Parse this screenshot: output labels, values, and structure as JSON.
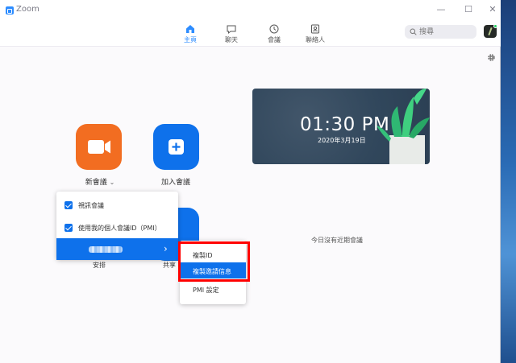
{
  "window": {
    "title": "Zoom"
  },
  "nav": {
    "tabs": [
      {
        "label": "主頁",
        "icon": "home-icon"
      },
      {
        "label": "聊天",
        "icon": "chat-icon"
      },
      {
        "label": "會議",
        "icon": "clock-icon"
      },
      {
        "label": "聯絡人",
        "icon": "contacts-icon"
      }
    ],
    "active_index": 0
  },
  "search": {
    "placeholder": "搜尋"
  },
  "actions": {
    "new_meeting_label": "新會議",
    "join_label": "加入會議",
    "schedule_label_partial": "安排",
    "share_label_partial": "共享"
  },
  "clock": {
    "time": "01:30 PM",
    "date": "2020年3月19日"
  },
  "no_meetings": "今日沒有近期會議",
  "new_meeting_menu": {
    "items": [
      {
        "label": "視訊會議",
        "checked": true
      },
      {
        "label": "使用我的個人會議ID（PMI）",
        "checked": true
      }
    ]
  },
  "pmi_submenu": {
    "items": [
      {
        "label": "複製ID"
      },
      {
        "label": "複製邀請信息"
      },
      {
        "label": "PMI 設定"
      }
    ],
    "selected_index": 1
  },
  "colors": {
    "accent": "#0e71eb",
    "orange": "#f26d21",
    "highlight": "#ff0000"
  }
}
